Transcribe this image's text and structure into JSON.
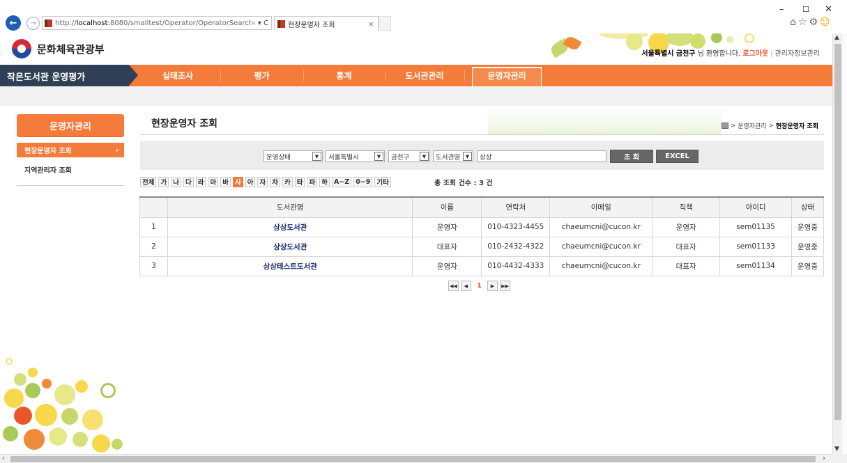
{
  "browser": {
    "url_prefix": "http://",
    "url_host": "localhost",
    "url_rest": ":8080/smalltest/Operator/OperatorSearch",
    "address_tools": "⌕ ▾ C",
    "tab_title": "현장운영자 조회",
    "tab_close": "×"
  },
  "header": {
    "ministry": "문화체육관광부",
    "user_name": "서울특별시 금천구",
    "user_suffix": " 님 환영합니다. ",
    "logout": "로그아웃",
    "separator": "|",
    "profile": "관리자정보관리"
  },
  "nav": {
    "site_title": "작은도서관 운영평가",
    "items": [
      "실태조사",
      "평가",
      "통계",
      "도서관관리",
      "운영자관리"
    ],
    "active_index": 4
  },
  "sidebar": {
    "title": "운영자관리",
    "items": [
      {
        "label": "현장운영자 조회",
        "active": true
      },
      {
        "label": "지역관리자 조회",
        "active": false
      }
    ],
    "active_arrow": "›"
  },
  "content": {
    "title": "현장운영자 조회",
    "breadcrumb": {
      "sep": ">",
      "parent": "운영자관리",
      "current": "현장운영자 조회"
    }
  },
  "search": {
    "status_select": "운영상태",
    "city_select": "서울특별시",
    "district_select": "금천구",
    "field_select": "도서관명",
    "keyword": "상상",
    "search_button": "조 회",
    "excel_button": "EXCEL"
  },
  "alphabet": {
    "items": [
      "전체",
      "가",
      "나",
      "다",
      "라",
      "마",
      "바",
      "사",
      "아",
      "자",
      "차",
      "카",
      "타",
      "파",
      "하",
      "A~Z",
      "0~9",
      "기타"
    ],
    "active": "사"
  },
  "total": {
    "label": "총 조회 건수 : ",
    "count": "3",
    "unit": " 건"
  },
  "table": {
    "headers": [
      "",
      "도서관명",
      "이름",
      "연락처",
      "이메일",
      "직책",
      "아이디",
      "상태"
    ],
    "rows": [
      [
        "1",
        "상상도서관",
        "운영자",
        "010-4323-4455",
        "chaeumcni@cucon.kr",
        "운영자",
        "sem01135",
        "운영중"
      ],
      [
        "2",
        "상상도서관",
        "대표자",
        "010-2432-4322",
        "chaeumcni@cucon.kr",
        "대표자",
        "sem01133",
        "운영중"
      ],
      [
        "3",
        "상상테스트도서관",
        "운영자",
        "010-4432-4333",
        "chaeumcni@cucon.kr",
        "대표자",
        "sem01134",
        "운영중"
      ]
    ]
  },
  "pager": {
    "first": "◀◀",
    "prev": "◀",
    "current": "1",
    "next": "▶",
    "last": "▶▶"
  },
  "colors": {
    "accent": "#f57b3a",
    "nav_dark": "#2f3f55",
    "link_text": "#1a2a6e",
    "logout": "#e8562b"
  }
}
